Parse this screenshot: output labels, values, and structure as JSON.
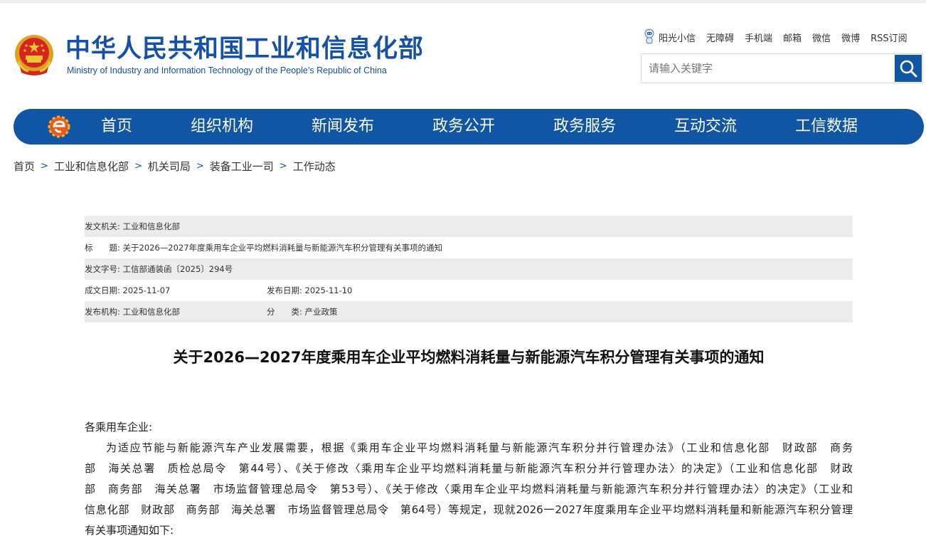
{
  "header": {
    "title_cn": "中华人民共和国工业和信息化部",
    "title_en": "Ministry of Industry and Information Technology of the People’s Republic of China",
    "toplinks": [
      "阳光小信",
      "无障碍",
      "手机端",
      "邮箱",
      "微信",
      "微博",
      "RSS订阅"
    ],
    "search_placeholder": "请输入关键字"
  },
  "colors": {
    "brand_blue": "#1156a5",
    "title_blue": "#1551a7",
    "meta_shade": "#ececec"
  },
  "nav": {
    "items": [
      "首页",
      "组织机构",
      "新闻发布",
      "政务公开",
      "政务服务",
      "互动交流",
      "工信数据"
    ]
  },
  "breadcrumb": [
    "首页",
    "工业和信息化部",
    "机关司局",
    "装备工业一司",
    "工作动态"
  ],
  "meta": {
    "issuer_label": "发文机关:",
    "issuer": "工业和信息化部",
    "title_label": "标　　题:",
    "title": "关于2026—2027年度乘用车企业平均燃料消耗量与新能源汽车积分管理有关事项的通知",
    "docno_label": "发文字号:",
    "docno": "工信部通装函〔2025〕294号",
    "created_label": "成文日期:",
    "created": "2025-11-07",
    "published_label": "发布日期:",
    "published": "2025-11-10",
    "org_label": "发布机构:",
    "org": "工业和信息化部",
    "category_label": "分　　类:",
    "category": "产业政策"
  },
  "article": {
    "title": "关于2026—2027年度乘用车企业平均燃料消耗量与新能源汽车积分管理有关事项的通知",
    "salutation": "各乘用车企业:",
    "lines": [
      "为适应节能与新能源汽车产业发展需要，根据《乘用车企业平均燃料消耗量与新能源汽车积分并行管理办法》（工业和信息化部　财政部　商务",
      "部　海关总署　质检总局令　第44号）、《关于修改〈乘用车企业平均燃料消耗量与新能源汽车积分并行管理办法〉的决定》（工业和信息化部　财政",
      "部　商务部　海关总署　市场监督管理总局令　第53号）、《关于修改〈乘用车企业平均燃料消耗量与新能源汽车积分并行管理办法〉的决定》（工业和",
      "信息化部　财政部　商务部　海关总署　市场监督管理总局令　第64号）等规定，现就2026一2027年度乘用车企业平均燃料消耗量和新能源汽车积分管理",
      "有关事项通知如下:"
    ]
  }
}
